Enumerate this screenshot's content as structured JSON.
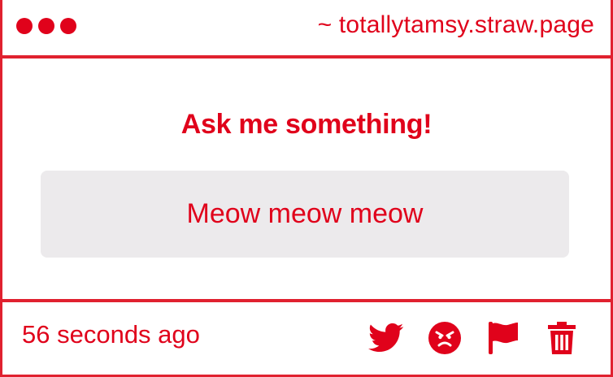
{
  "window": {
    "dots": [
      "dot-1",
      "dot-2",
      "dot-3"
    ],
    "url": "~ totallytamsy.straw.page"
  },
  "question": {
    "title": "Ask me something!",
    "text": "Meow meow meow"
  },
  "footer": {
    "timestamp": "56 seconds ago",
    "actions": [
      {
        "name": "twitter-icon"
      },
      {
        "name": "angry-face-icon"
      },
      {
        "name": "flag-icon"
      },
      {
        "name": "trash-icon"
      }
    ]
  },
  "colors": {
    "accent": "#e0021b",
    "border": "#e0212f",
    "box_bg": "#eceaec"
  }
}
